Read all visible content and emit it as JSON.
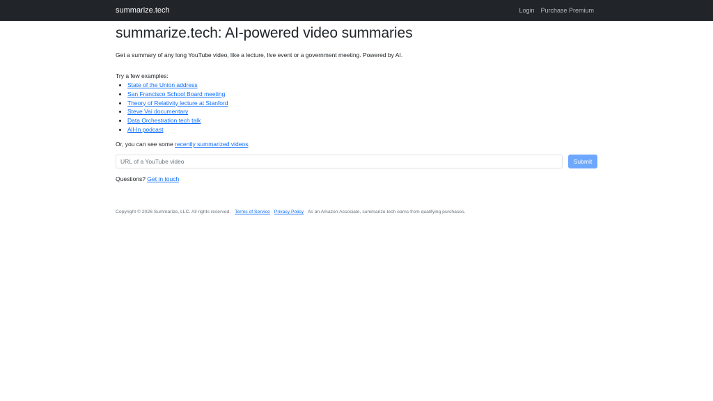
{
  "navbar": {
    "brand": "summarize.tech",
    "links": [
      {
        "label": "Login"
      },
      {
        "label": "Purchase Premium"
      }
    ]
  },
  "main": {
    "title": "summarize.tech: AI-powered video summaries",
    "lead": "Get a summary of any long YouTube video, like a lecture, live event or a government meeting. Powered by AI.",
    "examples_heading": "Try a few examples:",
    "examples": [
      {
        "label": "State of the Union address"
      },
      {
        "label": "San Francisco School Board meeting"
      },
      {
        "label": "Theory of Relativity lecture at Stanford"
      },
      {
        "label": "Steve Vai documentary"
      },
      {
        "label": "Data Orchestration tech talk"
      },
      {
        "label": "All-In podcast"
      }
    ],
    "recent_prefix": "Or, you can see some ",
    "recent_link": "recently summarized videos",
    "recent_suffix": ".",
    "url_input": {
      "placeholder": "URL of a YouTube video",
      "value": ""
    },
    "submit_label": "Submit",
    "questions_prefix": "Questions? ",
    "questions_link": "Get in touch"
  },
  "footer": {
    "copyright": "Copyright © 2026 Summarize, LLC. All rights reserved. · ",
    "terms": "Terms of Service",
    "sep": " · ",
    "privacy": "Privacy Policy",
    "affiliate": " · As an Amazon Associate, summarize.tech earns from qualifying purchases."
  },
  "colors": {
    "navbar_bg": "#212529",
    "link": "#0d6efd",
    "submit_bg": "#6ea8fe",
    "text": "#212529",
    "muted": "#6c757d"
  }
}
